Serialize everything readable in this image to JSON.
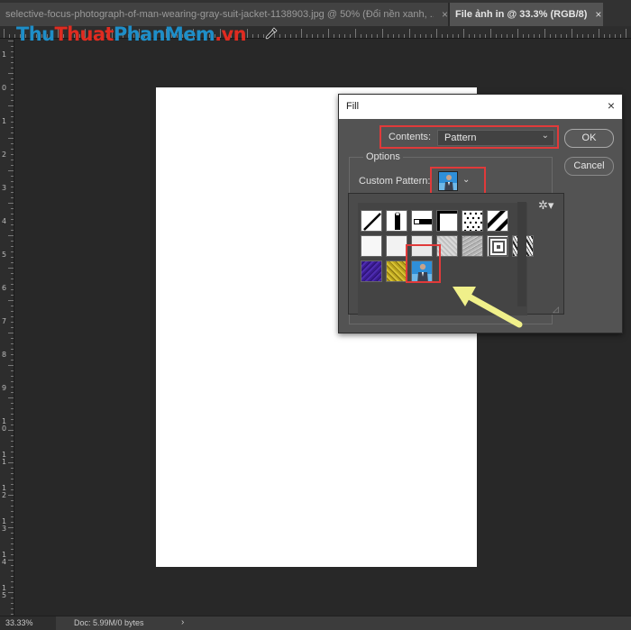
{
  "tabs": [
    {
      "title": "selective-focus-photograph-of-man-wearing-gray-suit-jacket-1138903.jpg @ 50% (Đổi nền xanh, ...",
      "active": false
    },
    {
      "title": "File ảnh in @ 33.3% (RGB/8)",
      "active": true
    }
  ],
  "tab_close_glyph": "×",
  "watermark": {
    "part1": "Thu",
    "part2": "Thuat",
    "part3": "PhanMem",
    "part4": ".vn"
  },
  "ruler_left_numbers": [
    "1",
    "0",
    "1",
    "2",
    "3",
    "4",
    "5",
    "6",
    "7",
    "8",
    "9",
    "1\n0",
    "1\n1",
    "1\n2",
    "1\n3",
    "1\n4",
    "1\n5"
  ],
  "status": {
    "zoom": "33.33%",
    "doc_info": "Doc: 5.99M/0 bytes",
    "arrow": "›"
  },
  "fill_dialog": {
    "title": "Fill",
    "close": "×",
    "contents_label": "Contents:",
    "contents_value": "Pattern",
    "ok_label": "OK",
    "cancel_label": "Cancel",
    "options_label": "Options",
    "custom_pattern_label": "Custom Pattern:",
    "chevron": "⌄"
  },
  "pattern_panel": {
    "gear": "✲▾",
    "grip": "◿"
  },
  "icons": {
    "eyedropper": "eyedropper-icon",
    "gear": "gear-icon"
  },
  "colors": {
    "highlight": "#e03a3a",
    "arrow": "#f0f08a",
    "panel": "#535353",
    "canvas": "#ffffff"
  }
}
